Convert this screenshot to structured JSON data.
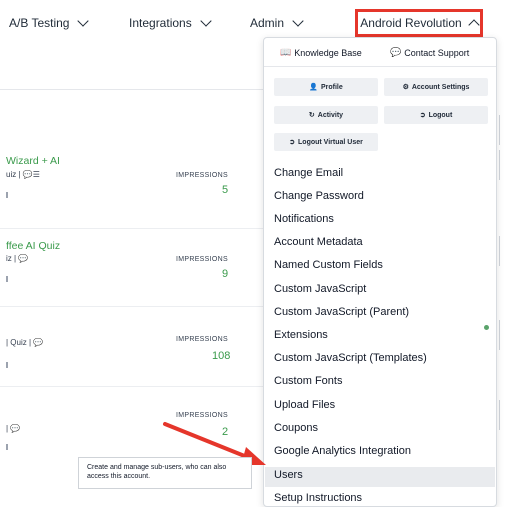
{
  "nav": {
    "ab_testing": "A/B Testing",
    "integrations": "Integrations",
    "admin": "Admin",
    "account": "Android Revolution"
  },
  "cards": [
    {
      "title": "Wizard + AI",
      "sub": "uiz | 💬☰",
      "imp_label": "IMPRESSIONS",
      "imp": "5"
    },
    {
      "title": "ffee AI Quiz",
      "sub": "iz | 💬",
      "imp_label": "IMPRESSIONS",
      "imp": "9"
    },
    {
      "title": "",
      "sub": "| Quiz | 💬",
      "imp_label": "IMPRESSIONS",
      "imp": "108"
    },
    {
      "title": "",
      "sub": "| 💬",
      "imp_label": "IMPRESSIONS",
      "imp": "2"
    }
  ],
  "dropdown": {
    "knowledge_base": "Knowledge Base",
    "contact_support": "Contact Support",
    "profile": "Profile",
    "account_settings": "Account Settings",
    "activity": "Activity",
    "logout": "Logout",
    "logout_virtual": "Logout Virtual User",
    "items": [
      "Change Email",
      "Change Password",
      "Notifications",
      "Account Metadata",
      "Named Custom Fields",
      "Custom JavaScript",
      "Custom JavaScript (Parent)",
      "Extensions",
      "Custom JavaScript (Templates)",
      "Custom Fonts",
      "Upload Files",
      "Coupons",
      "Google Analytics Integration",
      "Users",
      "Setup Instructions"
    ]
  },
  "tooltip": "Create and manage sub-users, who can also access this account.",
  "colors": {
    "accent_red": "#e5362b",
    "green": "#3a9a4b"
  }
}
